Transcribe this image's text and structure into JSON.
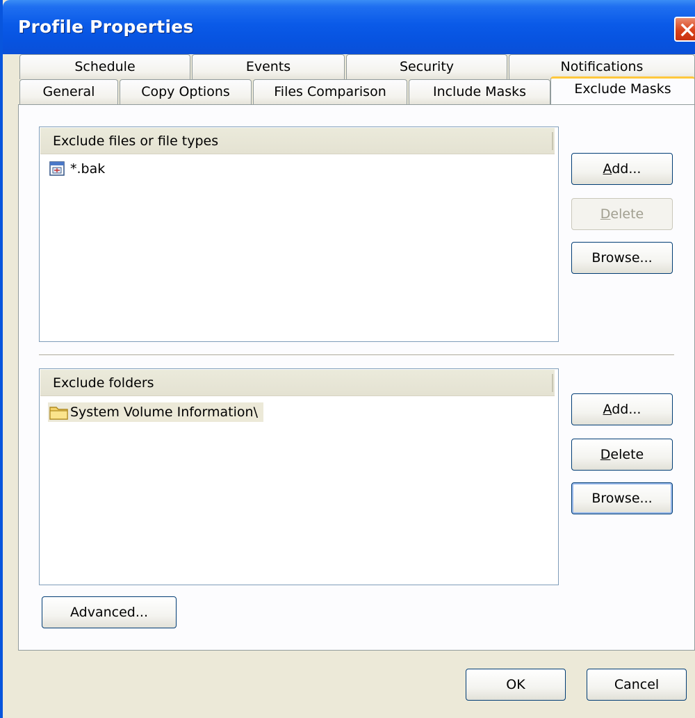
{
  "window": {
    "title": "Profile Properties"
  },
  "tabs_row1": [
    "Schedule",
    "Events",
    "Security",
    "Notifications"
  ],
  "tabs_row2": [
    "General",
    "Copy Options",
    "Files Comparison",
    "Include Masks",
    "Exclude Masks"
  ],
  "selected_tab": "Exclude Masks",
  "exclude_files": {
    "header": "Exclude files or file types",
    "items": [
      "*.bak"
    ],
    "buttons": {
      "add_accel": "A",
      "add_rest": "dd...",
      "delete_accel": "D",
      "delete_rest": "elete",
      "browse": "Browse..."
    },
    "delete_enabled": false
  },
  "exclude_folders": {
    "header": "Exclude folders",
    "items": [
      "System Volume Information\\"
    ],
    "buttons": {
      "add_accel": "A",
      "add_rest": "dd...",
      "delete_accel": "D",
      "delete_rest": "elete",
      "browse": "Browse..."
    }
  },
  "advanced_button": "Advanced...",
  "footer": {
    "ok": "OK",
    "cancel": "Cancel"
  },
  "icons": {
    "close": "close-icon",
    "file_mask": "file-type-icon",
    "folder": "folder-icon"
  },
  "colors": {
    "titlebar": "#0a5ae8",
    "dialog_bg": "#ece9d8",
    "selected_tab_accent": "#ffc83c",
    "close_button": "#d8431b"
  }
}
